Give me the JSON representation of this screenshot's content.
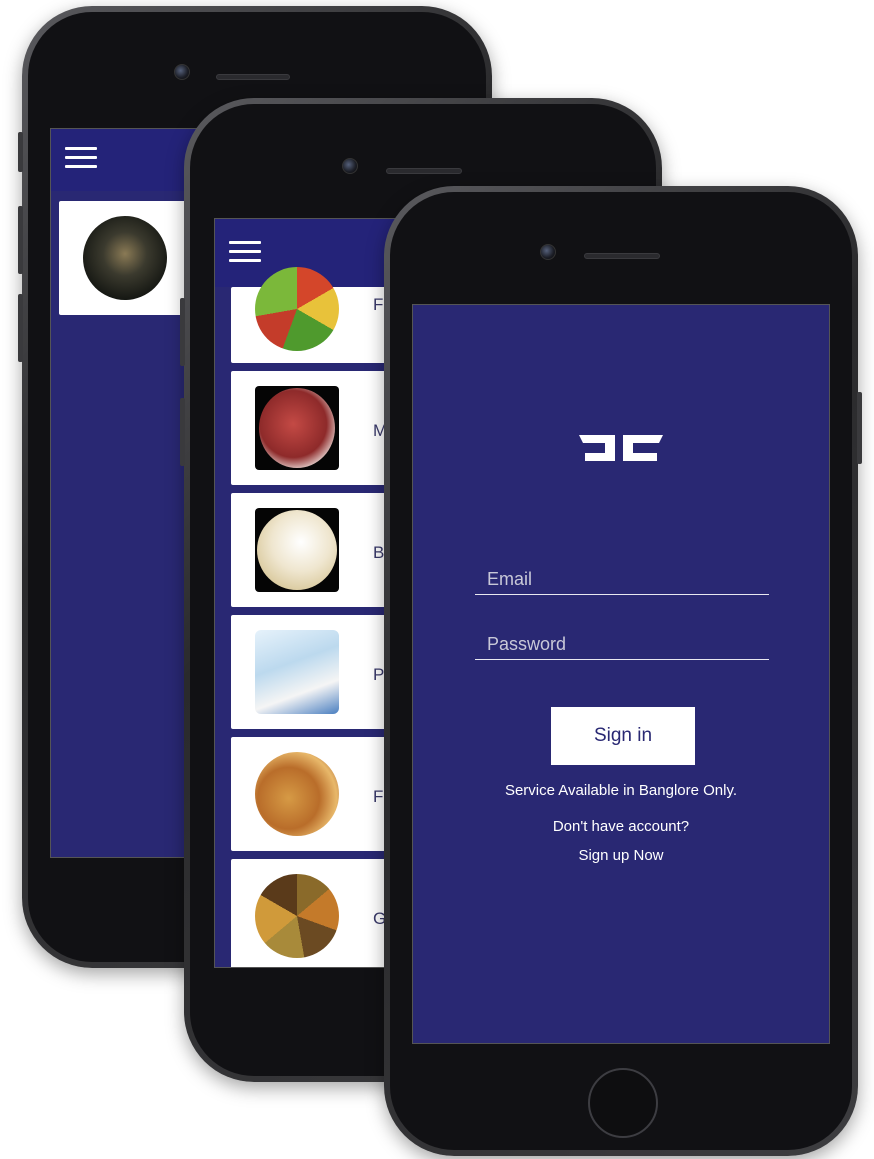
{
  "back_phone": {
    "menu_icon": "hamburger-icon",
    "thumbnail": "store-interior-thumbnail"
  },
  "middle_phone": {
    "menu_icon": "hamburger-icon",
    "categories": [
      {
        "letter": "F",
        "image": "vegetables-image"
      },
      {
        "letter": "M",
        "image": "meat-image"
      },
      {
        "letter": "B",
        "image": "dairy-image"
      },
      {
        "letter": "P",
        "image": "personal-care-image"
      },
      {
        "letter": "F",
        "image": "food-image"
      },
      {
        "letter": "G",
        "image": "grains-spices-image"
      }
    ]
  },
  "login": {
    "logo": "brand-logo",
    "email_placeholder": "Email",
    "password_placeholder": "Password",
    "signin_label": "Sign in",
    "service_note": "Service Available in Banglore Only.",
    "no_account": "Don't have account?",
    "signup_label": "Sign up Now"
  },
  "colors": {
    "primary": "#292873",
    "appbar": "#242379",
    "white": "#ffffff"
  }
}
